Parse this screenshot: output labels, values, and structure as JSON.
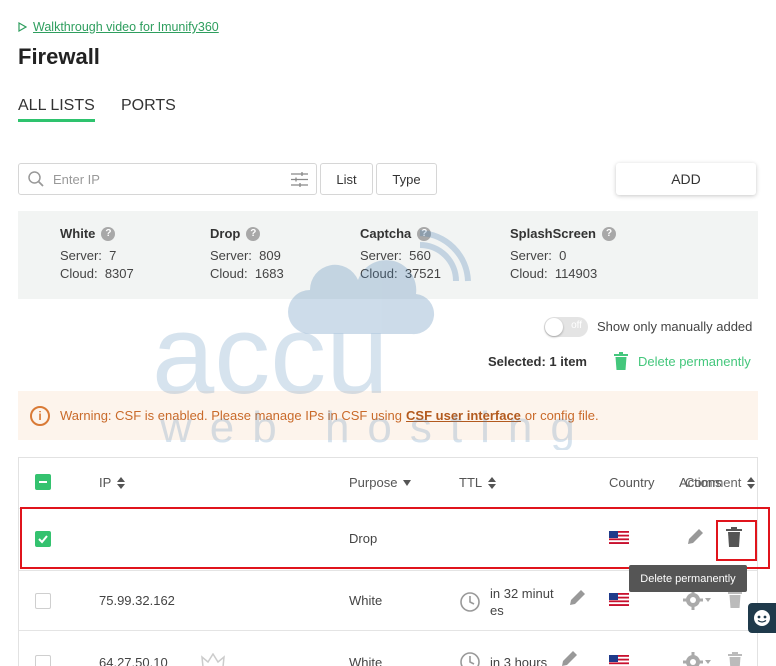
{
  "walkthrough": {
    "label": "Walkthrough video for Imunify360"
  },
  "page": {
    "title": "Firewall"
  },
  "tabs": [
    {
      "label": "ALL LISTS",
      "active": true
    },
    {
      "label": "PORTS",
      "active": false
    }
  ],
  "filters": {
    "search_placeholder": "Enter IP",
    "list_label": "List",
    "type_label": "Type",
    "add_label": "ADD"
  },
  "stats": [
    {
      "name": "White",
      "server_label": "Server:",
      "server": "7",
      "cloud_label": "Cloud:",
      "cloud": "8307"
    },
    {
      "name": "Drop",
      "server_label": "Server:",
      "server": "809",
      "cloud_label": "Cloud:",
      "cloud": "1683"
    },
    {
      "name": "Captcha",
      "server_label": "Server:",
      "server": "560",
      "cloud_label": "Cloud:",
      "cloud": "37521"
    },
    {
      "name": "SplashScreen",
      "server_label": "Server:",
      "server": "0",
      "cloud_label": "Cloud:",
      "cloud": "114903"
    }
  ],
  "toggle": {
    "state_text": "off",
    "label": "Show only manually added"
  },
  "selection": {
    "text": "Selected: 1 item",
    "delete_label": "Delete permanently"
  },
  "warning": {
    "prefix": "Warning: CSF is enabled. Please manage IPs in CSF using",
    "link": "CSF user interface",
    "suffix": "or config file."
  },
  "table": {
    "headers": {
      "ip": "IP",
      "purpose": "Purpose",
      "ttl": "TTL",
      "country": "Country",
      "actions": "Actions",
      "comment": "Comment"
    },
    "rows": [
      {
        "ip": "",
        "purpose": "Drop",
        "ttl": "",
        "checked": true
      },
      {
        "ip": "75.99.32.162",
        "purpose": "White",
        "ttl": "in 32 minut es",
        "checked": false
      },
      {
        "ip": "64.27.50.10",
        "purpose": "White",
        "ttl": "in 3 hours",
        "checked": false
      }
    ]
  },
  "tooltip": {
    "text": "Delete permanently"
  },
  "colors": {
    "accent": "#2ec36e",
    "warning_text": "#c96a2a",
    "highlight": "#e0141c"
  },
  "icons": [
    "play-icon",
    "search-icon",
    "filter-sliders-icon",
    "help-icon",
    "trash-icon",
    "warning-icon",
    "checkbox-icon",
    "sort-icon",
    "flag-us-icon",
    "pencil-icon",
    "trash-icon",
    "clock-icon",
    "gear-icon",
    "chat-icon",
    "crown-icon"
  ],
  "watermark": {
    "line1": "accu",
    "line2": "web hosting"
  }
}
